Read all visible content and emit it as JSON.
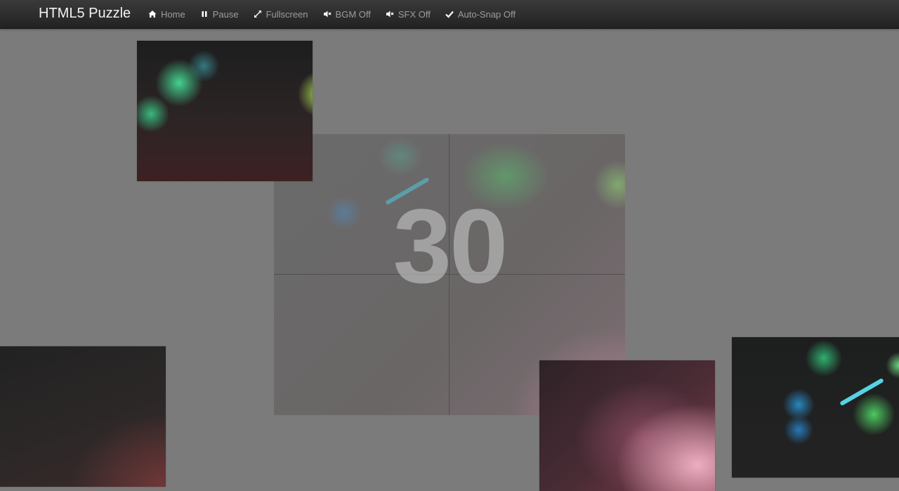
{
  "app": {
    "title": "HTML5 Puzzle"
  },
  "nav": {
    "items": [
      {
        "label": "Home",
        "icon": "home-icon"
      },
      {
        "label": "Pause",
        "icon": "pause-icon"
      },
      {
        "label": "Fullscreen",
        "icon": "fullscreen-icon"
      },
      {
        "label": "BGM Off",
        "icon": "volume-off-icon"
      },
      {
        "label": "SFX Off",
        "icon": "volume-off-icon"
      },
      {
        "label": "Auto-Snap Off",
        "icon": "checkmark-icon"
      }
    ]
  },
  "game": {
    "countdown": "30",
    "grid": {
      "rows": 2,
      "cols": 2
    }
  },
  "colors": {
    "background": "#7b7b7b",
    "navbar": "#2d2d2d",
    "nav_text": "#9d9d9d",
    "brand_text": "#f2f2f2"
  }
}
